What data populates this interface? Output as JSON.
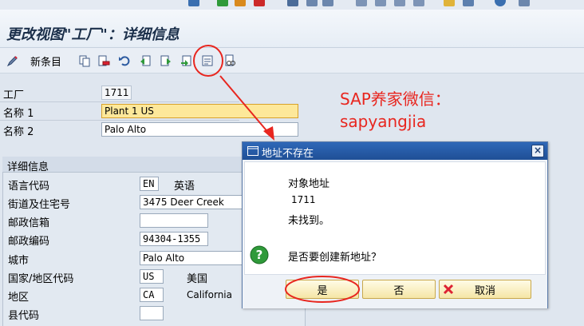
{
  "header": {
    "title": "更改视图\"工厂\"：详细信息"
  },
  "toolbar": {
    "new_entries": "新条目"
  },
  "form": {
    "plant_label": "工厂",
    "plant_value": "1711",
    "name1_label": "名称 1",
    "name1_value": "Plant 1 US",
    "name2_label": "名称 2",
    "name2_value": "Palo Alto"
  },
  "details": {
    "section_title": "详细信息",
    "rows": [
      {
        "label": "语言代码",
        "value": "EN",
        "desc": "英语"
      },
      {
        "label": "街道及住宅号",
        "value": "3475 Deer Creek"
      },
      {
        "label": "邮政信箱",
        "value": ""
      },
      {
        "label": "邮政编码",
        "value": "94304-1355"
      },
      {
        "label": "城市",
        "value": "Palo Alto"
      },
      {
        "label": "国家/地区代码",
        "value": "US",
        "desc": "美国"
      },
      {
        "label": "地区",
        "value": "CA",
        "desc": "California"
      },
      {
        "label": "县代码",
        "value": ""
      }
    ]
  },
  "annotation": {
    "line1": "SAP养家微信：",
    "line2": "sapyangjia"
  },
  "dialog": {
    "title": "地址不存在",
    "line1": "对象地址",
    "line2": "1711",
    "line3": "未找到。",
    "question": "是否要创建新地址？",
    "yes": "是",
    "no": "否",
    "cancel": "取消"
  },
  "colors": {
    "annotation_red": "#e8261f",
    "dialog_title_blue": "#2f68b8",
    "highlight_yellow": "#fde89a"
  }
}
